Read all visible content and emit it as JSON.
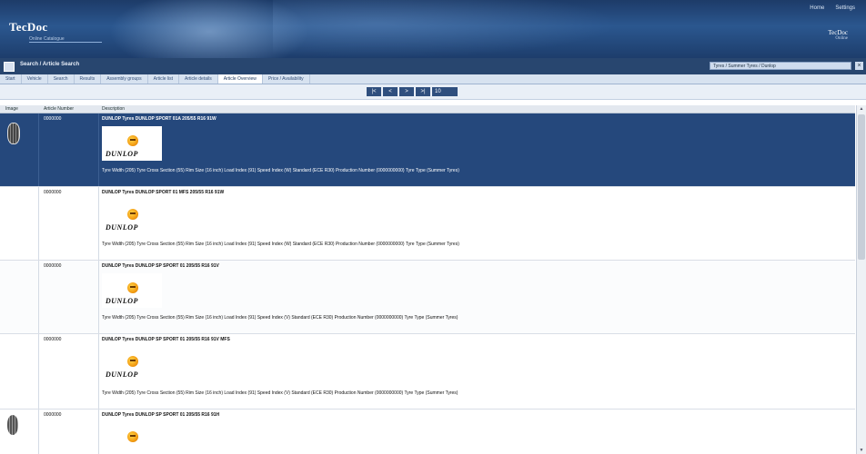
{
  "header": {
    "logo": "TecDoc",
    "tagline": "Online Catalogue",
    "top_links": [
      "Home",
      "Settings"
    ],
    "brand_right": "TecDoc",
    "brand_right_sub": "Online"
  },
  "titlebar": {
    "title": "Search / Article Search",
    "selector_value": "Tyres / Summer Tyres / Dunlop"
  },
  "breadcrumbs": [
    "Start",
    "Vehicle",
    "Search",
    "Results",
    "Assembly groups",
    "Article list",
    "Article details",
    "Article Overview",
    "Price / Availability"
  ],
  "active_breadcrumb_index": 7,
  "pager": {
    "first": "|<",
    "prev": "<",
    "next": ">",
    "last": ">|",
    "page_size": "10"
  },
  "table": {
    "columns": [
      "Image",
      "Article Number",
      "Description"
    ],
    "rows": [
      {
        "number": "0000000",
        "title": "DUNLOP Tyres DUNLOP SPORT 01A 205/55 R16 91W",
        "brand": "DUNLOP",
        "details": "Tyre Width (205) Tyre Cross Section (55) Rim Size (16 inch) Load Index (91) Speed Index (W) Standard (ECE R30) Production Number (0000000000) Tyre Type (Summer Tyres)"
      },
      {
        "number": "0000000",
        "title": "DUNLOP Tyres DUNLOP SPORT 01 MFS 205/55 R16 91W",
        "brand": "DUNLOP",
        "details": "Tyre Width (205) Tyre Cross Section (55) Rim Size (16 inch) Load Index (91) Speed Index (W) Standard (ECE R30) Production Number (0000000000) Tyre Type (Summer Tyres)"
      },
      {
        "number": "0000000",
        "title": "DUNLOP Tyres DUNLOP SP SPORT 01 205/55 R16 91V",
        "brand": "DUNLOP",
        "details": "Tyre Width (205) Tyre Cross Section (55) Rim Size (16 inch) Load Index (91) Speed Index (V) Standard (ECE R30) Production Number (0000000000) Tyre Type (Summer Tyres)"
      },
      {
        "number": "0000000",
        "title": "DUNLOP Tyres DUNLOP SP SPORT 01 205/55 R16 91V MFS",
        "brand": "DUNLOP",
        "details": "Tyre Width (205) Tyre Cross Section (55) Rim Size (16 inch) Load Index (91) Speed Index (V) Standard (ECE R30) Production Number (0000000000) Tyre Type (Summer Tyres)"
      },
      {
        "number": "0000000",
        "title": "DUNLOP Tyres DUNLOP SP SPORT 01 205/55 R16 91H",
        "brand": "DUNLOP"
      }
    ]
  }
}
